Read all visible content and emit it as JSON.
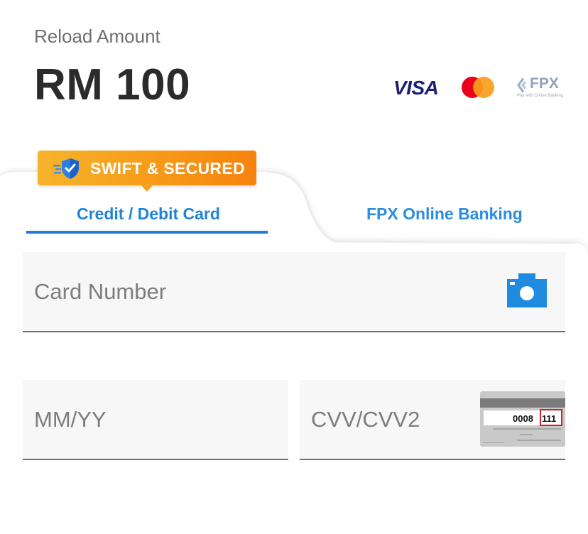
{
  "header": {
    "label": "Reload Amount",
    "amount": "RM 100"
  },
  "payment_logos": {
    "visa": "VISA",
    "fpx": "FPX",
    "fpx_sub": "Pay with Online Banking"
  },
  "badge": {
    "text": "SWIFT & SECURED"
  },
  "tabs": [
    {
      "label": "Credit / Debit Card",
      "active": true
    },
    {
      "label": "FPX Online Banking",
      "active": false
    }
  ],
  "form": {
    "card_number_placeholder": "Card Number",
    "expiry_placeholder": "MM/YY",
    "cvv_placeholder": "CVV/CVV2"
  },
  "cvv_hint": {
    "card_number_tail": "0008",
    "cvv_value": "111"
  },
  "colors": {
    "accent": "#1e7bd6",
    "badge_start": "#f6b42b",
    "badge_end": "#f7820e",
    "field_bg": "#f7f7f7"
  },
  "icons": [
    "shield-icon",
    "camera-icon",
    "visa-logo",
    "mastercard-logo",
    "fpx-logo",
    "cvv-card-hint-icon"
  ]
}
